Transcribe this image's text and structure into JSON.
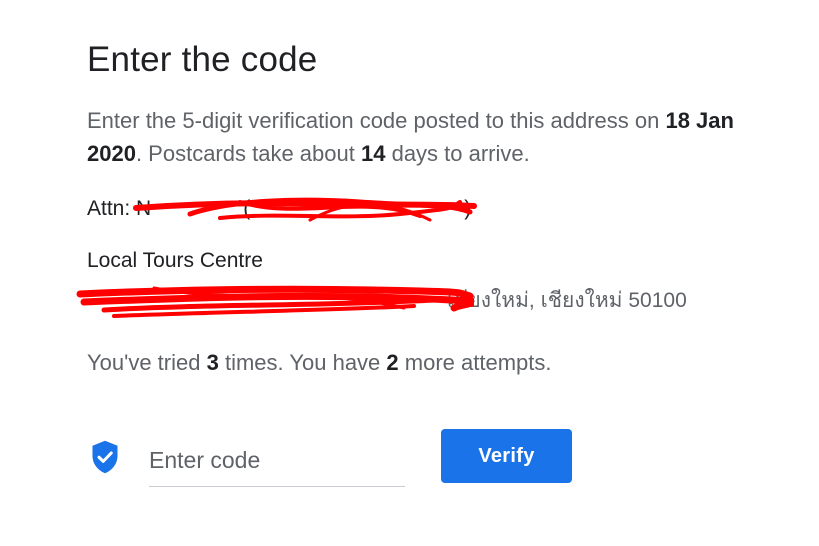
{
  "title": "Enter the code",
  "description": {
    "part1": "Enter the 5-digit verification code posted to this address on ",
    "date": "18 Jan 2020",
    "part2": ". Postcards take about ",
    "days": "14",
    "part3": " days to arrive."
  },
  "address": {
    "attn_prefix": "Attn: N",
    "attn_paren_open": "(",
    "attn_paren_close": ")",
    "business_name": "Local Tours Centre",
    "line2_visible": "เชียงใหม่, เชียงใหม่ 50100"
  },
  "attempts": {
    "part1": "You've tried ",
    "tried": "3",
    "part2": " times. You have ",
    "remaining": "2",
    "part3": " more attempts."
  },
  "code_field": {
    "placeholder": "Enter code",
    "value": ""
  },
  "verify_button": {
    "label": "Verify"
  },
  "colors": {
    "accent": "#1a73e8",
    "redaction": "#ff0000",
    "muted_text": "#5f6368"
  },
  "icons": {
    "shield": "verified-shield-icon"
  }
}
